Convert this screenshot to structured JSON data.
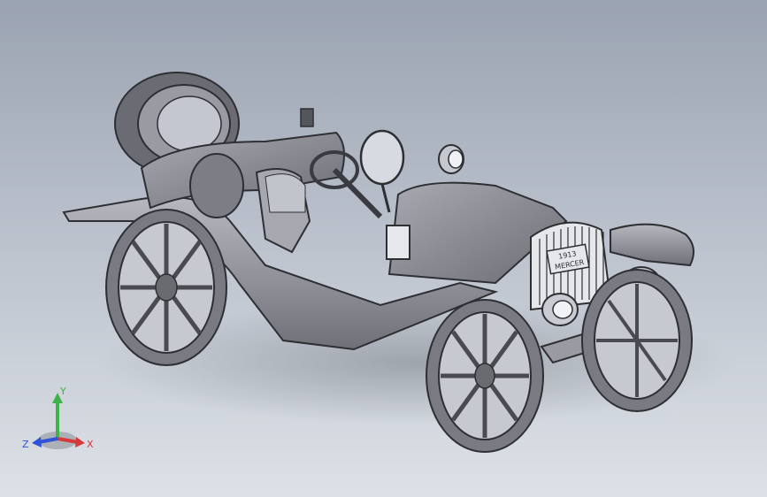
{
  "viewport": {
    "background_top": "#9aa3b1",
    "background_bottom": "#dde1e7"
  },
  "model": {
    "grille_text_line1": "1913",
    "grille_text_line2": "MERCER",
    "body_color": "#8e8e96",
    "shadow_color": "#6f737b"
  },
  "triad": {
    "x_label": "X",
    "y_label": "Y",
    "z_label": "Z",
    "x_color": "#d43a3a",
    "y_color": "#3fb24a",
    "z_color": "#2f52d8"
  }
}
